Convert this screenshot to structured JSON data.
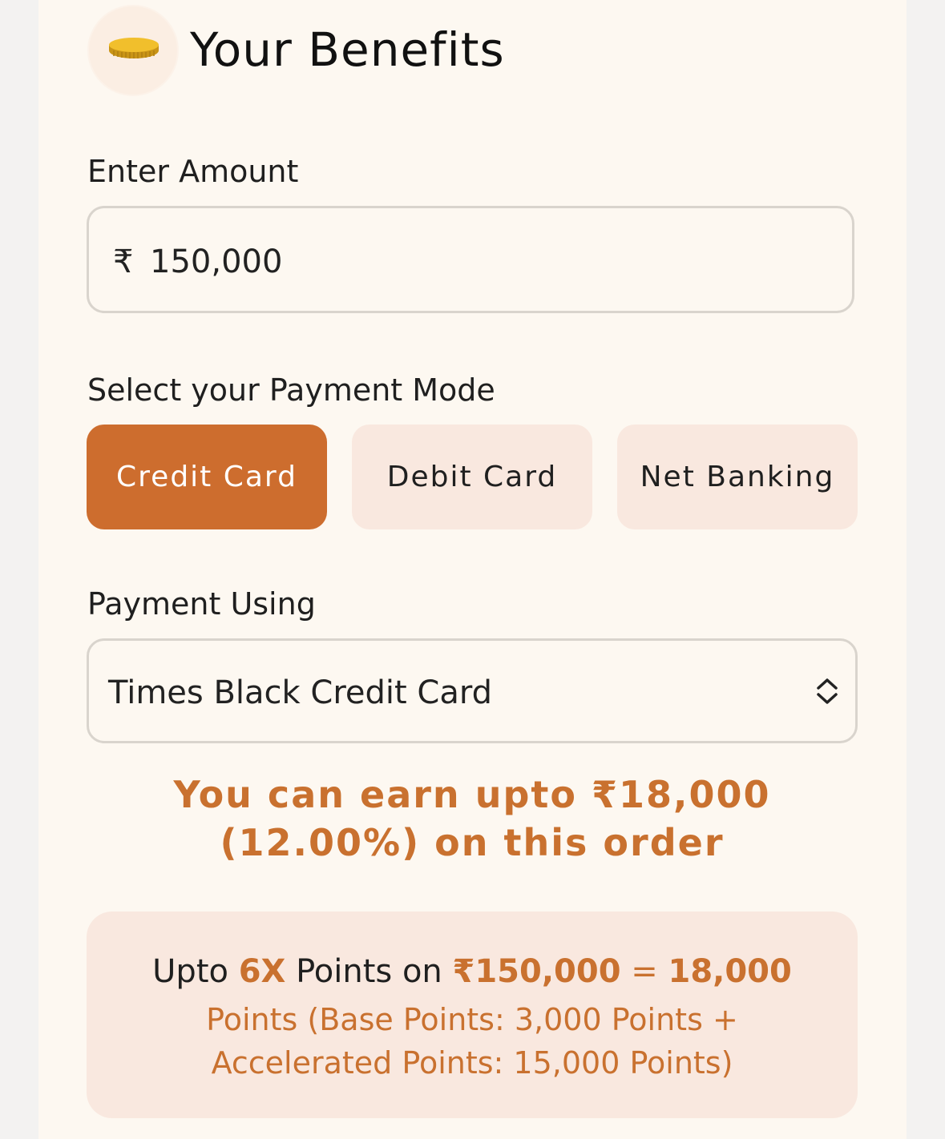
{
  "header": {
    "icon": "coin-icon",
    "title": "Your Benefits"
  },
  "amount": {
    "label": "Enter Amount",
    "currency_symbol": "₹",
    "value": "150,000"
  },
  "payment_mode": {
    "label": "Select your Payment Mode",
    "options": [
      {
        "label": "Credit Card",
        "selected": true
      },
      {
        "label": "Debit Card",
        "selected": false
      },
      {
        "label": "Net Banking",
        "selected": false
      }
    ]
  },
  "payment_using": {
    "label": "Payment Using",
    "selected_value": "Times Black Credit Card",
    "icon": "chevron-up-down-icon"
  },
  "earn": {
    "line1": "You can earn upto ₹18,000",
    "line2": "(12.00%) on this order"
  },
  "points_summary": {
    "prefix": "Upto ",
    "multiplier": "6X",
    "middle": " Points on ",
    "amount": "₹150,000",
    "equals": " = ",
    "total": "18,000",
    "detail_line1": "Points (Base Points: 3,000 Points +",
    "detail_line2": "Accelerated Points: 15,000 Points)"
  },
  "colors": {
    "accent": "#cd6d2e",
    "accent_text": "#c9712f",
    "inactive_button_bg": "#f9e8df",
    "card_bg": "#fdf8f1",
    "page_bg": "#f3f2f1"
  }
}
